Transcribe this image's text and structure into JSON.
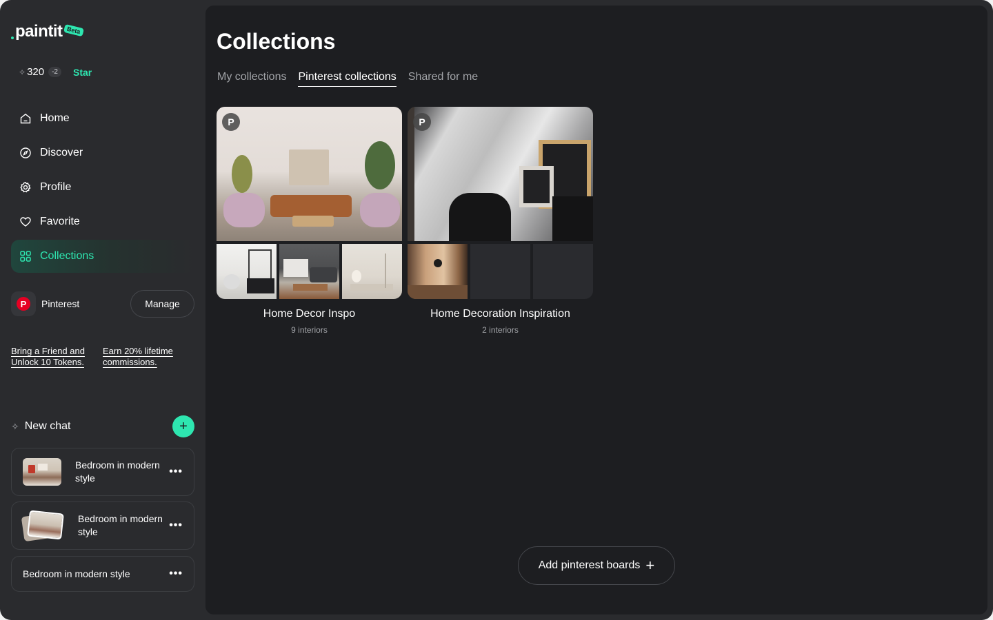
{
  "brand": {
    "name": "paintit",
    "badge": "Beta",
    "accent_color": "#2ee6b0"
  },
  "tokens": {
    "count": "320",
    "delta": "-2",
    "star_label": "Star"
  },
  "nav": {
    "items": [
      {
        "label": "Home",
        "icon": "home-icon",
        "active": false
      },
      {
        "label": "Discover",
        "icon": "compass-icon",
        "active": false
      },
      {
        "label": "Profile",
        "icon": "gear-icon",
        "active": false
      },
      {
        "label": "Favorite",
        "icon": "heart-icon",
        "active": false
      },
      {
        "label": "Collections",
        "icon": "grid-icon",
        "active": true
      }
    ]
  },
  "pinterest": {
    "label": "Pinterest",
    "manage_label": "Manage",
    "brand_color": "#e60023"
  },
  "promo": {
    "left": "Bring a Friend and Unlock 10 Tokens.",
    "right": "Earn 20% lifetime commissions."
  },
  "chat": {
    "new_chat_label": "New chat",
    "items": [
      {
        "title": "Bedroom in modern style",
        "has_thumb": true
      },
      {
        "title": "Bedroom in modern style",
        "has_thumb": true
      },
      {
        "title": "Bedroom in modern style",
        "has_thumb": false
      }
    ]
  },
  "main": {
    "title": "Collections",
    "tabs": [
      {
        "label": "My collections",
        "active": false
      },
      {
        "label": "Pinterest collections",
        "active": true
      },
      {
        "label": "Shared for me",
        "active": false
      }
    ],
    "collections": [
      {
        "name": "Home Decor Inspo",
        "count": "9 interiors"
      },
      {
        "name": "Home Decoration Inspiration",
        "count": "2 interiors"
      }
    ],
    "add_button_label": "Add pinterest boards"
  }
}
